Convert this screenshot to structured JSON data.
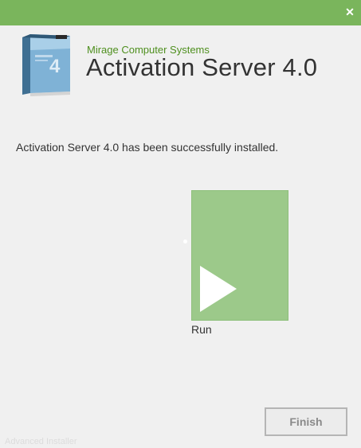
{
  "window": {
    "close_symbol": "✕",
    "accent_color": "#7ab55c"
  },
  "header": {
    "company": "Mirage Computer Systems",
    "product_title": "Activation Server 4.0",
    "box_icon": "product-box-icon"
  },
  "body": {
    "message": "Activation Server 4.0 has been successfully installed."
  },
  "run_tile": {
    "label": "Run",
    "icon": "play-icon",
    "color": "#9cc98a"
  },
  "footer": {
    "finish_label": "Finish",
    "watermark": "Advanced Installer"
  }
}
